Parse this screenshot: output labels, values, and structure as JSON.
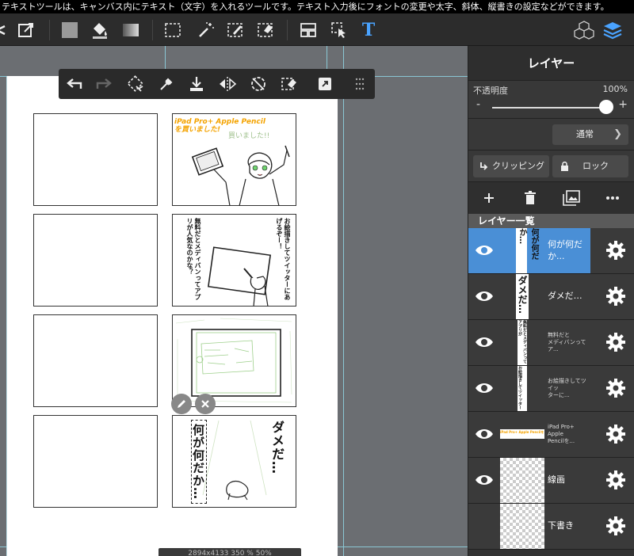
{
  "hint": "テキストツールは、キャンバス内にテキスト（文字）を入れるツールです。テキスト入力後にフォントの変更や太字、斜体、縦書きの設定などができます。",
  "toolbar": {
    "tools": [
      "undo-icon",
      "edit-icon",
      "fill-color-icon",
      "bucket-icon",
      "gradient-icon",
      "select-icon",
      "magic-wand-icon",
      "select-pen-icon",
      "select-eraser-icon",
      "panel-layout-icon",
      "move-cursor-icon",
      "text-tool-icon",
      "material-icon",
      "layers-icon"
    ],
    "text_tool_label": "T",
    "accent": "#4aa3ff"
  },
  "subtoolbar": {
    "tools": [
      "undo-icon",
      "redo-icon",
      "lasso-icon",
      "eyedropper-icon",
      "download-icon",
      "flip-icon",
      "rotate-icon",
      "eraser-icon",
      "transform-icon",
      "grip-icon"
    ]
  },
  "canvas": {
    "panel1": {
      "title": "iPad Pro+ Apple Pencilを買いました!",
      "note": "買いました!!"
    },
    "panel2": {
      "col1": "お絵描きしてツイッターにあげるぞー！",
      "col2": "無料だとメディバンってアプリが人気なのかな？"
    },
    "panel4": {
      "text1": "ダメだ…",
      "text2": "何が何だか…"
    },
    "status": "2894x4133    350 %  50%"
  },
  "layers_panel": {
    "title": "レイヤー",
    "opacity_label": "不透明度",
    "opacity_value": "100%",
    "opacity_level": 1.0,
    "minus": "-",
    "plus": "+",
    "blend_mode": "通常",
    "clipping_label": "クリッピング",
    "lock_label": "ロック",
    "list_header": "レイヤー一覧",
    "layers": [
      {
        "name": "何が何だか...",
        "visible": true,
        "selected": true,
        "thumb_text": "何が何だか…"
      },
      {
        "name": "ダメだ…",
        "visible": true,
        "selected": false,
        "thumb_text": "ダメだ…"
      },
      {
        "name": "無料だと\nメディバンってア...",
        "visible": true,
        "selected": false,
        "thumb_text": "無料だとメディバンってアプリが"
      },
      {
        "name": "お絵描きしてツイッ\nターに...",
        "visible": true,
        "selected": false,
        "thumb_text": "お絵描きしてツイッター"
      },
      {
        "name": "iPad Pro+ Apple\nPencilを...",
        "visible": true,
        "selected": false,
        "thumb_text": "iPad Pro+ Apple Pencilを"
      },
      {
        "name": "線画",
        "visible": true,
        "selected": false,
        "thumb_text": ""
      },
      {
        "name": "下書き",
        "visible": false,
        "selected": false,
        "thumb_text": ""
      }
    ]
  }
}
